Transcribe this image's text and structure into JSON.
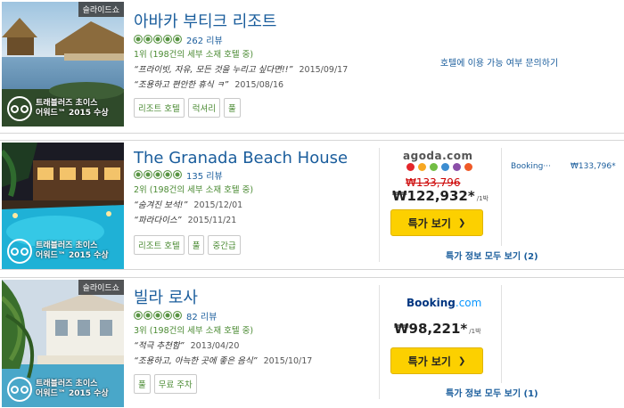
{
  "listings": [
    {
      "slide_badge": "슬라이드쇼",
      "award_line1": "트래블러즈 초이스",
      "award_line2": "어워드™ 2015 수상",
      "title": "아바카 부티크 리조트",
      "rating_bubbles": 5,
      "review_count": "262 리뷰",
      "rank": "1위 (198건의 세부 소재 호텔 중)",
      "quotes": [
        {
          "text": "“프라이빗, 자유, 모든 것을 누리고 싶다면!!”",
          "date": "2015/09/17"
        },
        {
          "text": "“조용하고 편안한 휴식 ㅋ”",
          "date": "2015/08/16"
        }
      ],
      "tags": [
        "리조트 호텔",
        "럭셔리",
        "풀"
      ],
      "availability_text": "호텔에 이용 가능 여부 문의하기"
    },
    {
      "slide_badge": "",
      "award_line1": "트래블러즈 초이스",
      "award_line2": "어워드™ 2015 수상",
      "title": "The Granada Beach House",
      "rating_bubbles": 5,
      "review_count": "135 리뷰",
      "rank": "2위 (198건의 세부 소재 호텔 중)",
      "quotes": [
        {
          "text": "“숨겨진 보석!”",
          "date": "2015/12/01"
        },
        {
          "text": "“파라다이스”",
          "date": "2015/11/21"
        }
      ],
      "tags": [
        "리조트 호텔",
        "풀",
        "중간급"
      ],
      "provider_logo": "agoda.com",
      "provider_dot_colors": [
        "#e4262b",
        "#f7a823",
        "#72bd44",
        "#3c8dd1",
        "#8b4fa8",
        "#ef5a28"
      ],
      "price_strike": "₩133,796",
      "price": "₩122,932*",
      "price_per": "/1박",
      "deal_button": "특가 보기",
      "all_deals": "특가 정보 모두 보기 (2)",
      "alt_provider": "Booking···",
      "alt_price": "₩133,796*"
    },
    {
      "slide_badge": "슬라이드쇼",
      "award_line1": "트래블러즈 초이스",
      "award_line2": "어워드™ 2015 수상",
      "title": "빌라 로사",
      "rating_bubbles": 5,
      "review_count": "82 리뷰",
      "rank": "3위 (198건의 세부 소재 호텔 중)",
      "quotes": [
        {
          "text": "“적극 추천함”",
          "date": "2013/04/20"
        },
        {
          "text": "“조용하고, 아늑한 곳에 좋은 음식”",
          "date": "2015/10/17"
        }
      ],
      "tags": [
        "풀",
        "무료 주차"
      ],
      "provider_logo_main": "Booking",
      "provider_logo_suffix": ".com",
      "price": "₩98,221*",
      "price_per": "/1박",
      "deal_button": "특가 보기",
      "all_deals": "특가 정보 모두 보기 (1)"
    }
  ]
}
